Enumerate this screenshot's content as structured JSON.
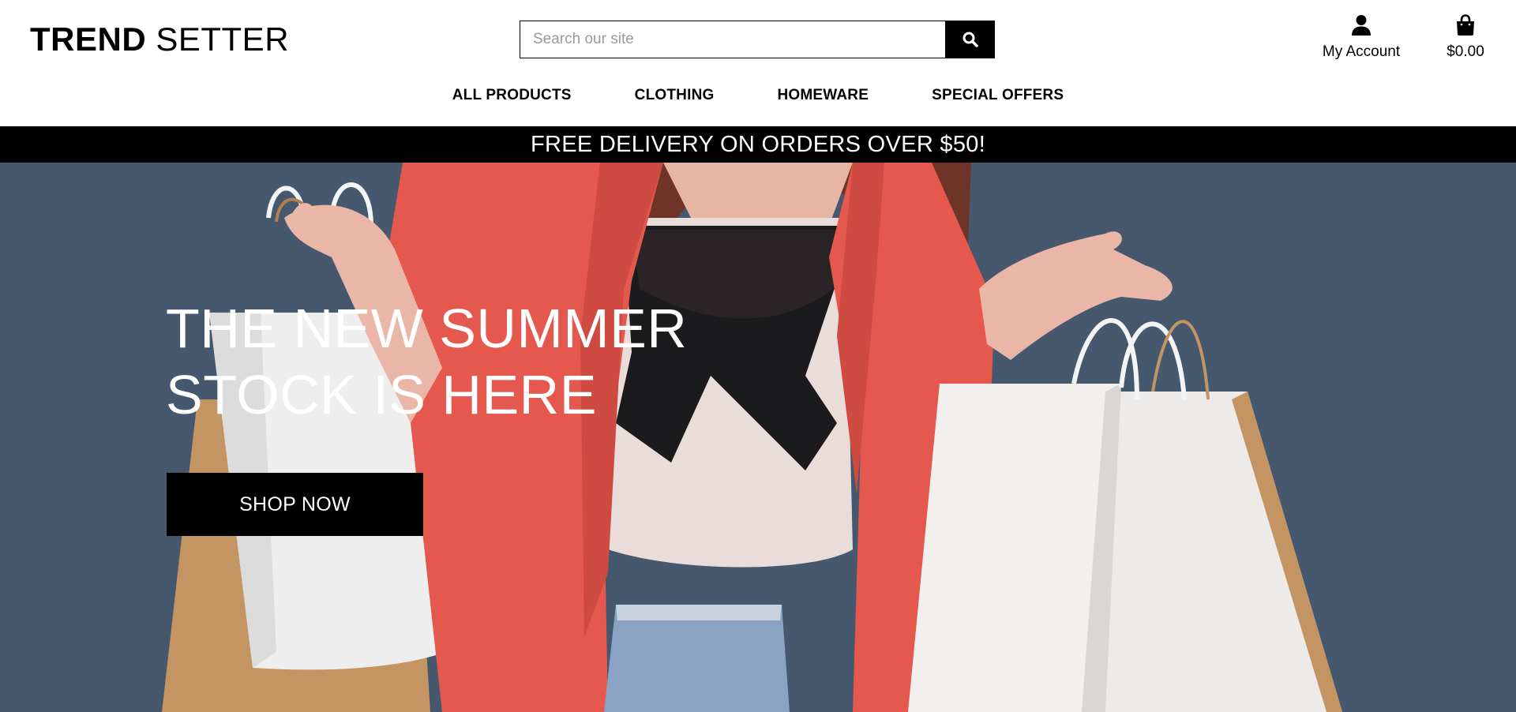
{
  "brand": {
    "name_bold": "TREND",
    "name_light": "SETTER"
  },
  "search": {
    "placeholder": "Search our site",
    "value": "",
    "icon": "search-icon"
  },
  "account": {
    "label": "My Account",
    "icon": "user-icon"
  },
  "bag": {
    "total": "$0.00",
    "icon": "shopping-bag-icon"
  },
  "nav": {
    "items": [
      "ALL PRODUCTS",
      "CLOTHING",
      "HOMEWARE",
      "SPECIAL OFFERS"
    ]
  },
  "banner": {
    "text": "FREE DELIVERY ON ORDERS OVER $50!"
  },
  "hero": {
    "title_line1": "THE NEW SUMMER",
    "title_line2": "STOCK IS HERE",
    "cta": "SHOP NOW",
    "image_description": "woman in red blazer holding white shopping bags"
  },
  "colors": {
    "banner_bg": "#000000",
    "hero_bg": "#46586e",
    "blazer": "#e4584d",
    "button_bg": "#000000"
  }
}
